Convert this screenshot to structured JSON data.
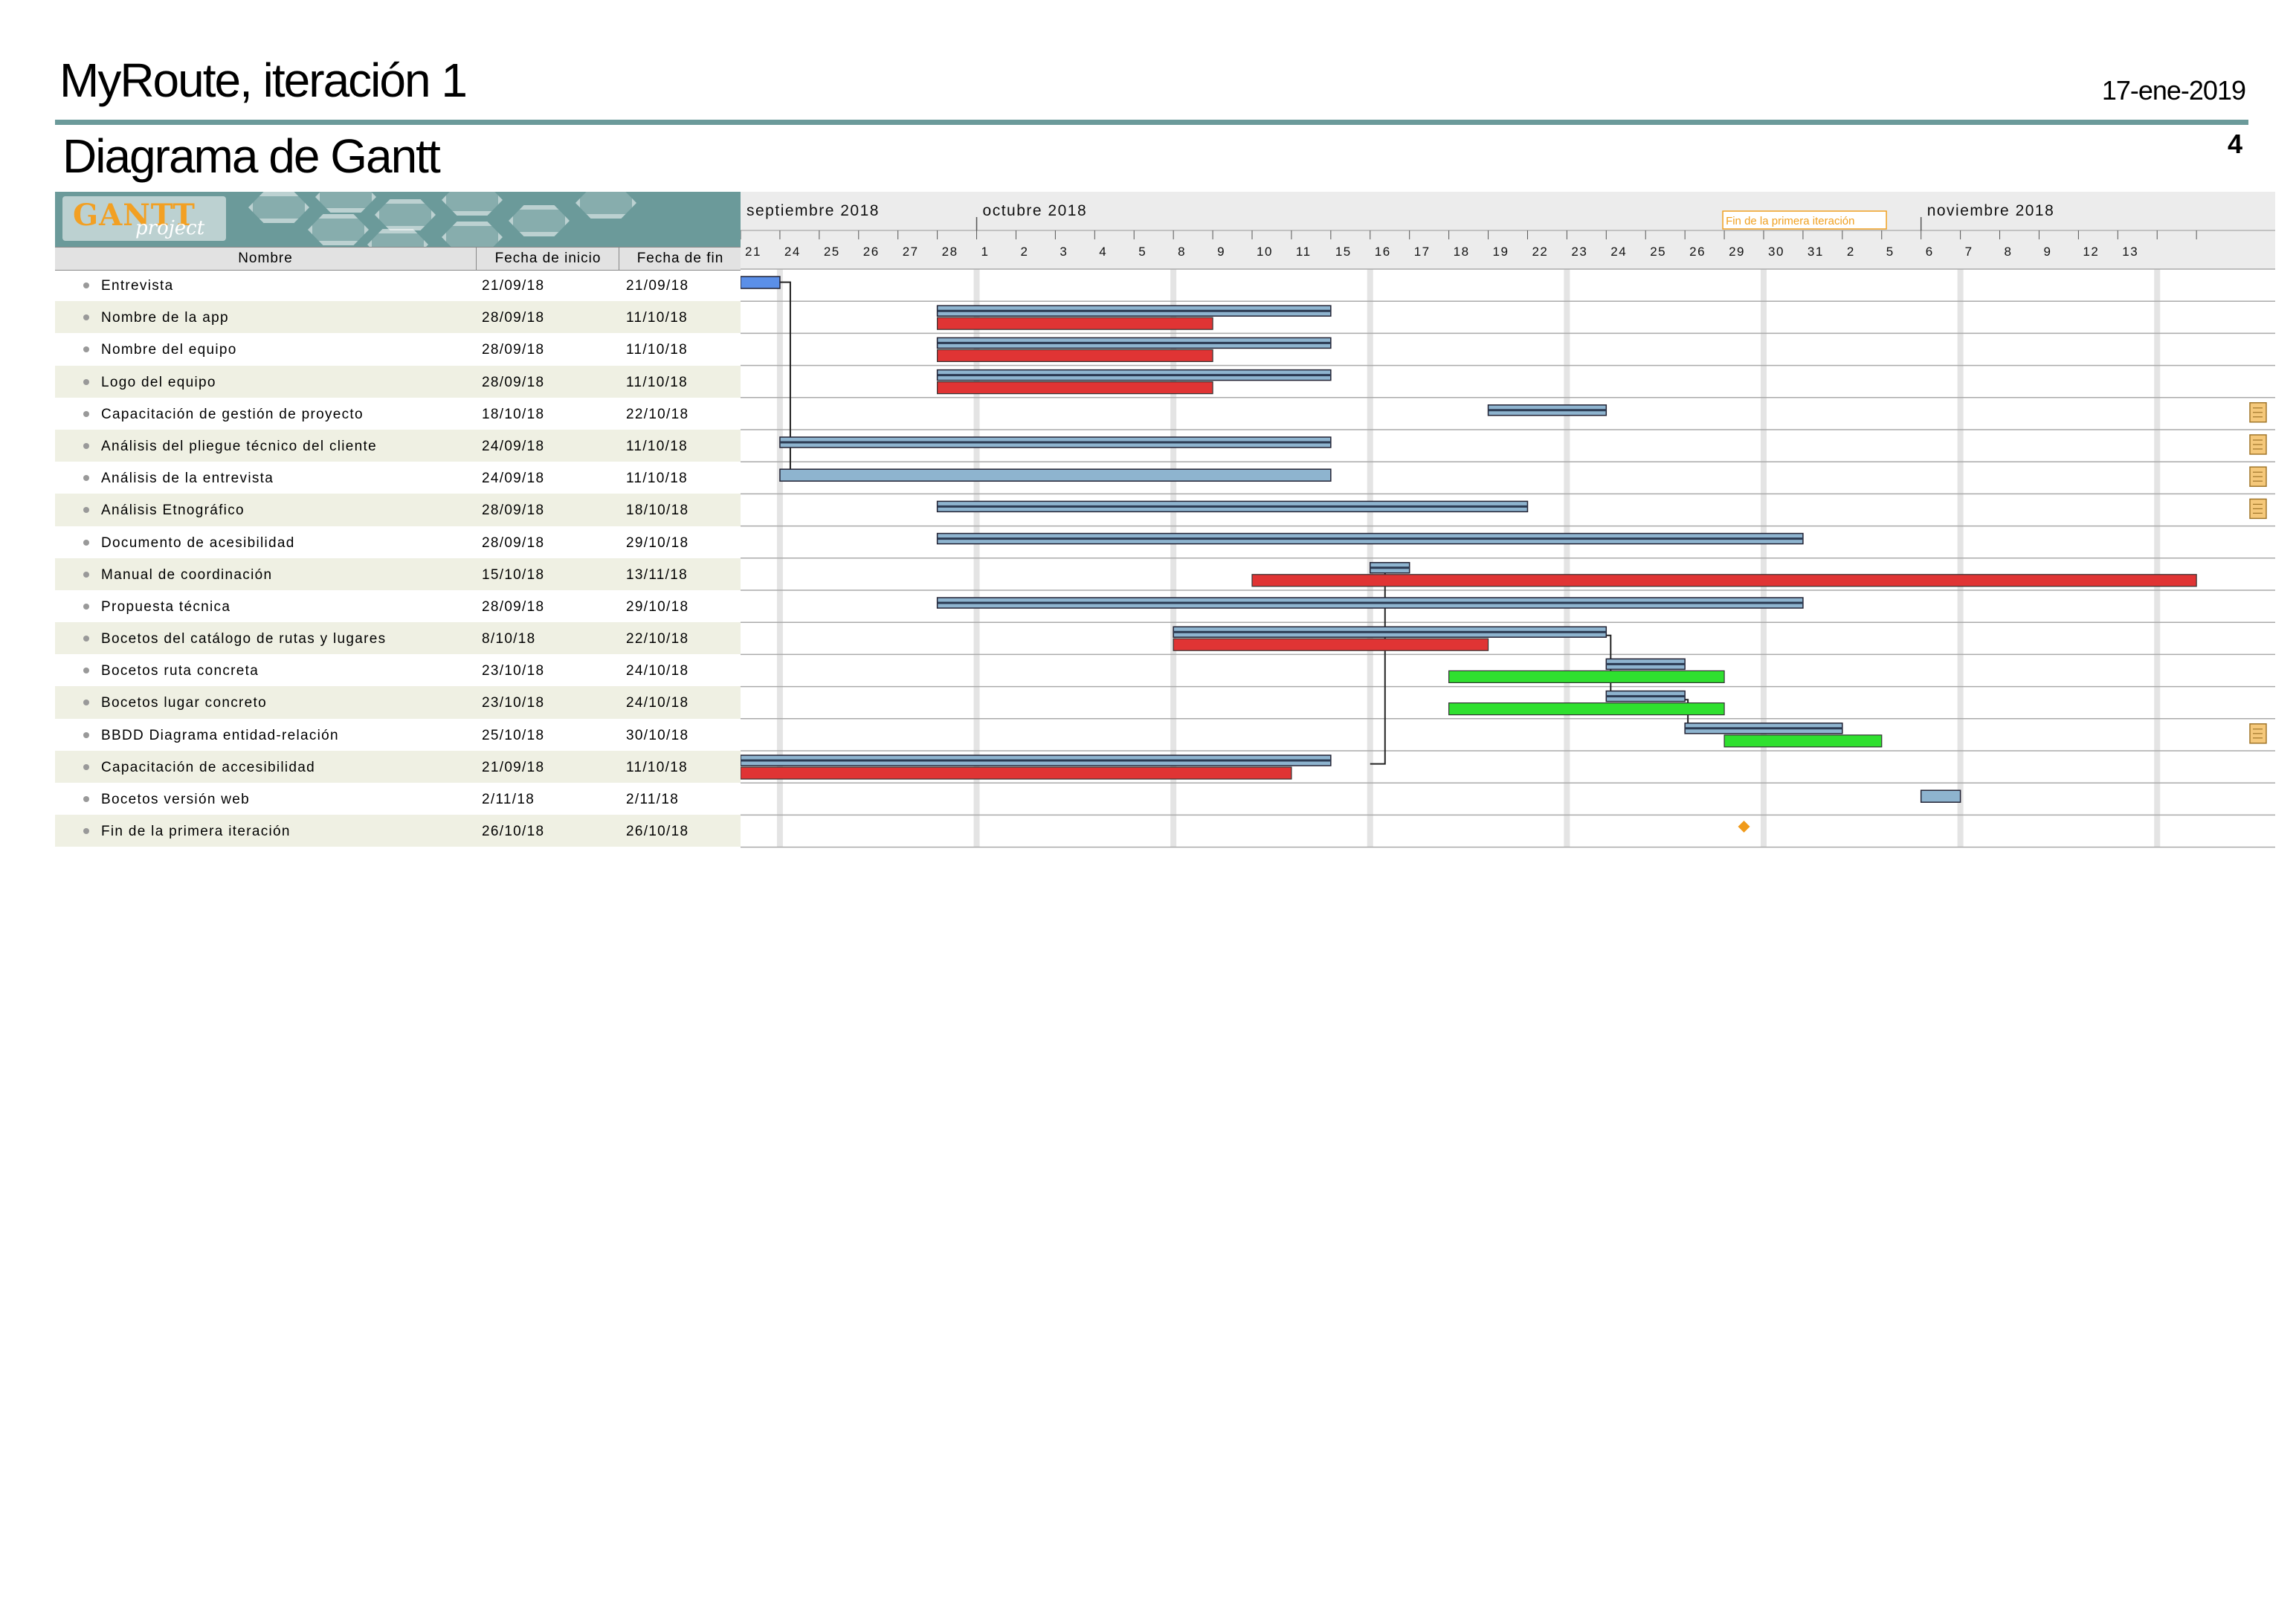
{
  "header": {
    "title": "MyRoute, iteración 1",
    "date": "17-ene-2019",
    "subtitle": "Diagrama de Gantt",
    "page_number": "4"
  },
  "logo": {
    "main": "GANTT",
    "sub": "project"
  },
  "table": {
    "columns": [
      "Nombre",
      "Fecha de inicio",
      "Fecha de fin"
    ],
    "rows": [
      {
        "name": "Entrevista",
        "start": "21/09/18",
        "end": "21/09/18"
      },
      {
        "name": "Nombre de la app",
        "start": "28/09/18",
        "end": "11/10/18"
      },
      {
        "name": "Nombre del equipo",
        "start": "28/09/18",
        "end": "11/10/18"
      },
      {
        "name": "Logo del equipo",
        "start": "28/09/18",
        "end": "11/10/18"
      },
      {
        "name": "Capacitación de gestión de proyecto",
        "start": "18/10/18",
        "end": "22/10/18"
      },
      {
        "name": "Análisis del pliegue técnico del cliente",
        "start": "24/09/18",
        "end": "11/10/18"
      },
      {
        "name": "Análisis de la entrevista",
        "start": "24/09/18",
        "end": "11/10/18"
      },
      {
        "name": "Análisis Etnográfico",
        "start": "28/09/18",
        "end": "18/10/18"
      },
      {
        "name": "Documento de acesibilidad",
        "start": "28/09/18",
        "end": "29/10/18"
      },
      {
        "name": "Manual de coordinación",
        "start": "15/10/18",
        "end": "13/11/18"
      },
      {
        "name": "Propuesta técnica",
        "start": "28/09/18",
        "end": "29/10/18"
      },
      {
        "name": "Bocetos del catálogo de rutas y lugares",
        "start": "8/10/18",
        "end": "22/10/18"
      },
      {
        "name": "Bocetos ruta concreta",
        "start": "23/10/18",
        "end": "24/10/18"
      },
      {
        "name": "Bocetos lugar concreto",
        "start": "23/10/18",
        "end": "24/10/18"
      },
      {
        "name": "BBDD Diagrama entidad-relación",
        "start": "25/10/18",
        "end": "30/10/18"
      },
      {
        "name": "Capacitación de accesibilidad",
        "start": "21/09/18",
        "end": "11/10/18"
      },
      {
        "name": "Bocetos versión web",
        "start": "2/11/18",
        "end": "2/11/18"
      },
      {
        "name": "Fin de la primera iteración",
        "start": "26/10/18",
        "end": "26/10/18"
      }
    ]
  },
  "chart_data": {
    "type": "gantt",
    "months": [
      {
        "label": "septiembre 2018",
        "start_day": "21"
      },
      {
        "label": "octubre 2018",
        "start_day": "1"
      },
      {
        "label": "noviembre 2018",
        "start_day": "2"
      }
    ],
    "day_ticks": [
      "21",
      "24",
      "25",
      "26",
      "27",
      "28",
      "1",
      "2",
      "3",
      "4",
      "5",
      "8",
      "9",
      "10",
      "11",
      "15",
      "16",
      "17",
      "18",
      "19",
      "22",
      "23",
      "24",
      "25",
      "26",
      "29",
      "30",
      "31",
      "2",
      "5",
      "6",
      "7",
      "8",
      "9",
      "12",
      "13"
    ],
    "milestone_label": "Fin de la primera iteración",
    "colors": {
      "task": "#8eb4cf",
      "summary_line": "#2b3a52",
      "baseline_late": "#e03434",
      "baseline_early": "#2fe02f",
      "first_task": "#5b8fe8",
      "milestone": "#f09a1a",
      "note_icon": "#f5c87a",
      "weekend": "#e4e4e4"
    },
    "tasks": [
      {
        "row": 0,
        "start": "2018-09-21",
        "end": "2018-09-21",
        "style": "solid-blue"
      },
      {
        "row": 1,
        "start": "2018-09-28",
        "end": "2018-10-11",
        "style": "striped",
        "baseline": {
          "start": "2018-09-28",
          "end": "2018-10-08",
          "color": "red"
        }
      },
      {
        "row": 2,
        "start": "2018-09-28",
        "end": "2018-10-11",
        "style": "striped",
        "baseline": {
          "start": "2018-09-28",
          "end": "2018-10-08",
          "color": "red"
        }
      },
      {
        "row": 3,
        "start": "2018-09-28",
        "end": "2018-10-11",
        "style": "striped",
        "baseline": {
          "start": "2018-09-28",
          "end": "2018-10-08",
          "color": "red"
        }
      },
      {
        "row": 4,
        "start": "2018-10-18",
        "end": "2018-10-22",
        "style": "striped",
        "note": true
      },
      {
        "row": 5,
        "start": "2018-09-24",
        "end": "2018-10-11",
        "style": "striped",
        "note": true
      },
      {
        "row": 6,
        "start": "2018-09-24",
        "end": "2018-10-11",
        "style": "solid",
        "note": true
      },
      {
        "row": 7,
        "start": "2018-09-28",
        "end": "2018-10-18",
        "style": "striped",
        "note": true
      },
      {
        "row": 8,
        "start": "2018-09-28",
        "end": "2018-10-29",
        "style": "striped"
      },
      {
        "row": 9,
        "start": "2018-10-15",
        "end": "2018-11-13",
        "style": "striped",
        "baseline": {
          "start": "2018-10-10",
          "end": "2018-11-12",
          "color": "red"
        }
      },
      {
        "row": 10,
        "start": "2018-09-28",
        "end": "2018-10-29",
        "style": "striped"
      },
      {
        "row": 11,
        "start": "2018-10-08",
        "end": "2018-10-22",
        "style": "striped",
        "baseline": {
          "start": "2018-10-08",
          "end": "2018-10-17",
          "color": "red"
        }
      },
      {
        "row": 12,
        "start": "2018-10-23",
        "end": "2018-10-24",
        "style": "striped",
        "baseline": {
          "start": "2018-10-17",
          "end": "2018-10-25",
          "color": "green"
        }
      },
      {
        "row": 13,
        "start": "2018-10-23",
        "end": "2018-10-24",
        "style": "striped",
        "baseline": {
          "start": "2018-10-17",
          "end": "2018-10-25",
          "color": "green"
        }
      },
      {
        "row": 14,
        "start": "2018-10-25",
        "end": "2018-10-30",
        "style": "striped",
        "note": true,
        "baseline": {
          "start": "2018-10-26",
          "end": "2018-10-31",
          "color": "green"
        }
      },
      {
        "row": 15,
        "start": "2018-09-21",
        "end": "2018-10-11",
        "style": "striped",
        "baseline": {
          "start": "2018-09-21",
          "end": "2018-10-10",
          "color": "red"
        }
      },
      {
        "row": 16,
        "start": "2018-11-02",
        "end": "2018-11-02",
        "style": "solid"
      },
      {
        "row": 17,
        "start": "2018-10-26",
        "end": "2018-10-26",
        "style": "milestone"
      }
    ]
  }
}
